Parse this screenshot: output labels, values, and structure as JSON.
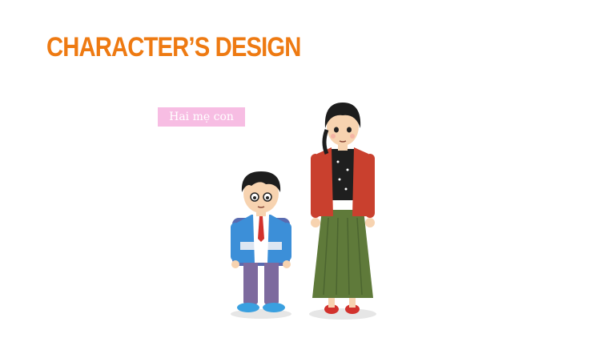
{
  "slide": {
    "title": "CHARACTER’S DESIGN",
    "label": "Hai mẹ con"
  },
  "colors": {
    "title": "#ee7a12",
    "label_bg": "#f7bde3",
    "label_text": "#ffffff"
  },
  "characters": [
    {
      "name": "boy",
      "description_icon": "student-boy-illustration"
    },
    {
      "name": "mother",
      "description_icon": "mother-illustration"
    }
  ]
}
